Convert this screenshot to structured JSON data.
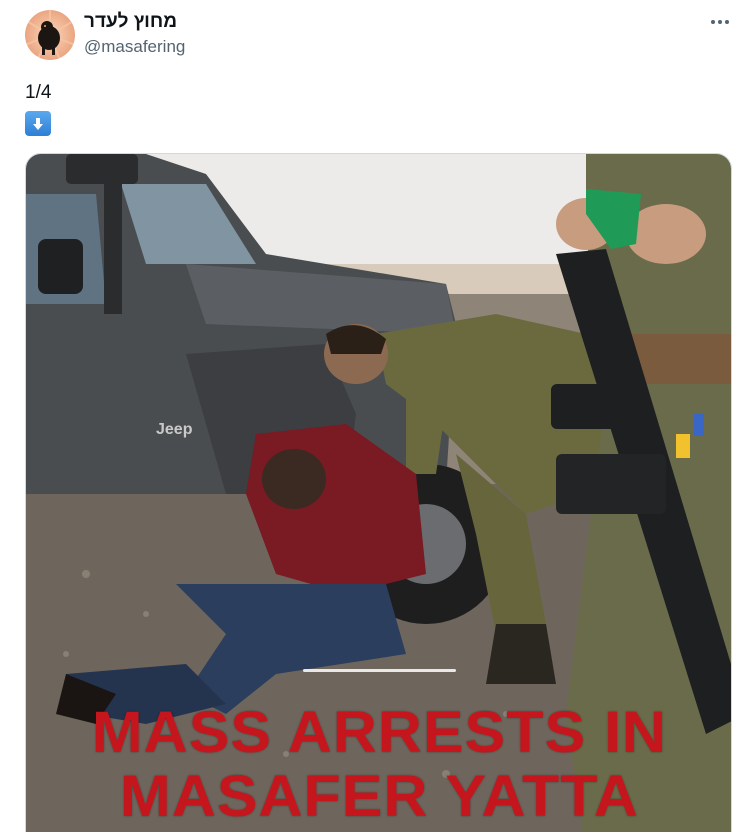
{
  "author": {
    "display_name": "מחוץ לעדר",
    "handle": "@masafering",
    "avatar": "black-sheep-avatar"
  },
  "tweet": {
    "text": "1/4",
    "emoji": "down-arrow-emoji"
  },
  "menu": {
    "icon": "more-options-icon"
  },
  "media": {
    "headline_line1": "MASS ARRESTS IN",
    "headline_line2": "MASAFER YATTA",
    "jeep_badge": "Jeep",
    "headline_color": "#c4161c"
  }
}
